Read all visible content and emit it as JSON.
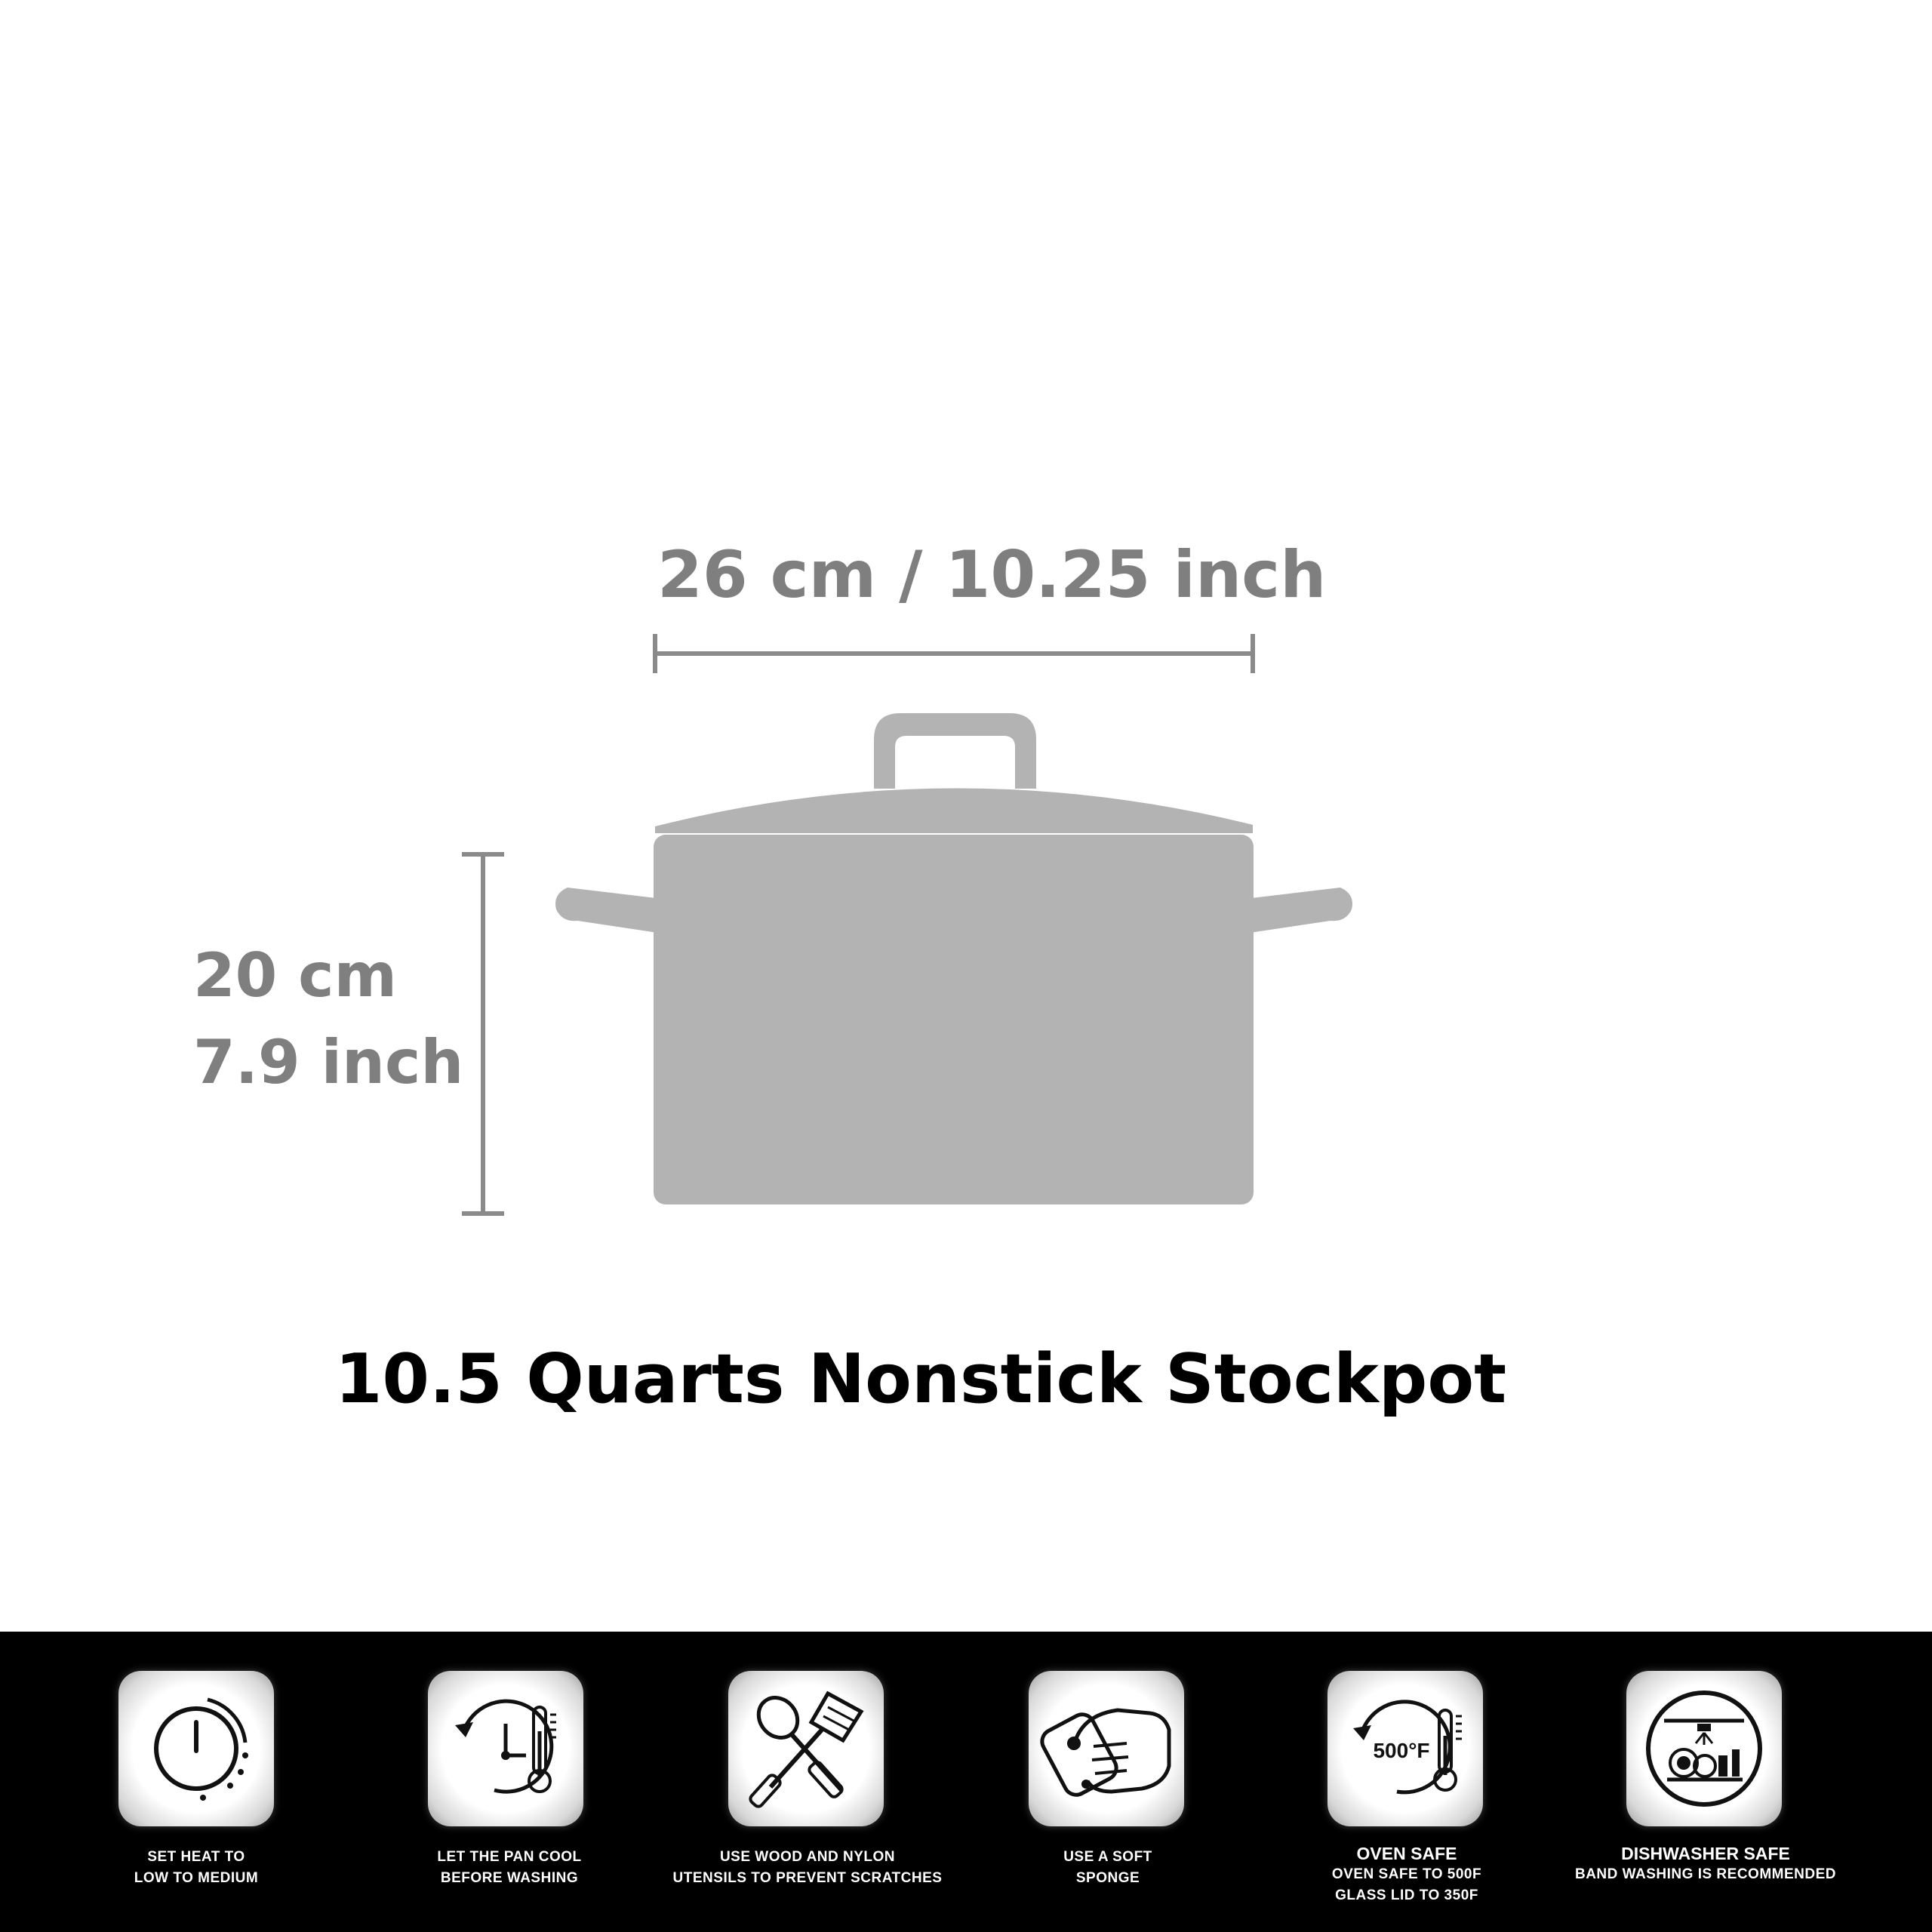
{
  "dimensions": {
    "width_label": "26 cm / 10.25 inch",
    "height_label_line1": "20 cm",
    "height_label_line2": "7.9 inch"
  },
  "product_title": "10.5 Quarts Nonstick Stockpot",
  "colors": {
    "pot_fill": "#b3b3b3",
    "dimension_text": "#7f7f7f",
    "band_background": "#000000"
  },
  "care_icons": [
    {
      "icon": "power-dial-icon",
      "lines": [
        "SET HEAT TO",
        "LOW TO MEDIUM"
      ]
    },
    {
      "icon": "clock-thermometer-icon",
      "lines": [
        "LET THE PAN COOL",
        "BEFORE WASHING"
      ]
    },
    {
      "icon": "spoon-spatula-icon",
      "lines": [
        "USE WOOD AND NYLON",
        "UTENSILS TO PREVENT SCRATCHES"
      ]
    },
    {
      "icon": "hand-sponge-icon",
      "lines": [
        "USE A SOFT",
        "SPONGE"
      ]
    },
    {
      "icon": "oven-500f-icon",
      "heading": "OVEN SAFE",
      "lines": [
        "OVEN SAFE TO 500F",
        "GLASS LID TO 350F"
      ],
      "badge": "500°F"
    },
    {
      "icon": "dishwasher-icon",
      "heading": "DISHWASHER SAFE",
      "lines": [
        "BAND WASHING IS RECOMMENDED"
      ]
    }
  ]
}
